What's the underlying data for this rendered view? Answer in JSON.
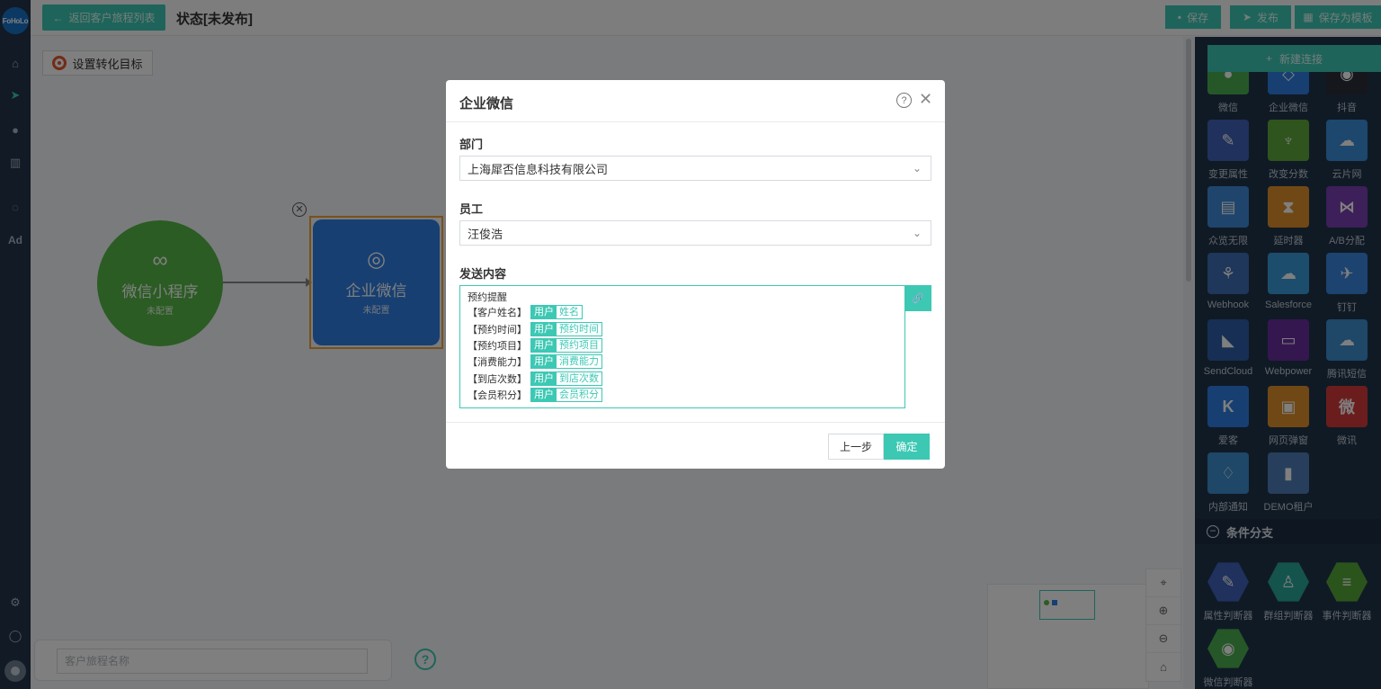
{
  "nav": {
    "logo": "FoHoLo",
    "ad_label": "Ad"
  },
  "topbar": {
    "back_label": "返回客户旅程列表",
    "status": "状态[未发布]",
    "save_label": "保存",
    "publish_label": "发布",
    "save_template_label": "保存为模板"
  },
  "canvas": {
    "goal_label": "设置转化目标",
    "node1": {
      "title": "微信小程序",
      "sub": "未配置"
    },
    "node2": {
      "title": "企业微信",
      "sub": "未配置"
    },
    "search_placeholder": "客户旅程名称",
    "help": "?"
  },
  "panel": {
    "new_connection": "新建连接",
    "tools": [
      {
        "label": "微信",
        "color": "#4caf50"
      },
      {
        "label": "企业微信",
        "color": "#2f7fe4"
      },
      {
        "label": "抖音",
        "color": "#2d2d3a"
      },
      {
        "label": "变更属性",
        "color": "#3f63b8"
      },
      {
        "label": "改变分数",
        "color": "#5ea83a"
      },
      {
        "label": "云片网",
        "color": "#3a8fd9"
      },
      {
        "label": "众览无限",
        "color": "#3e8bd8"
      },
      {
        "label": "延时器",
        "color": "#e0912a"
      },
      {
        "label": "A/B分配",
        "color": "#7b3fb3"
      },
      {
        "label": "Webhook",
        "color": "#3d6fb5"
      },
      {
        "label": "Salesforce",
        "color": "#3a9ad9"
      },
      {
        "label": "钉钉",
        "color": "#3a86e0"
      },
      {
        "label": "SendCloud",
        "color": "#2f5fa8"
      },
      {
        "label": "Webpower",
        "color": "#6a2fa0"
      },
      {
        "label": "腾讯短信",
        "color": "#3c8fd0"
      },
      {
        "label": "爱客",
        "color": "#2f7fe4"
      },
      {
        "label": "网页弹窗",
        "color": "#e0912a"
      },
      {
        "label": "微讯",
        "color": "#d63a3a"
      },
      {
        "label": "内部通知",
        "color": "#3c8fd0"
      },
      {
        "label": "DEMO租户",
        "color": "#4f7fb8"
      }
    ],
    "section": "条件分支",
    "judges": [
      {
        "label": "属性判断器",
        "color": "#3f63b8"
      },
      {
        "label": "群组判断器",
        "color": "#2aa69a"
      },
      {
        "label": "事件判断器",
        "color": "#56a83a"
      },
      {
        "label": "微信判断器",
        "color": "#4caf50"
      }
    ]
  },
  "modal": {
    "title": "企业微信",
    "dept_label": "部门",
    "dept_value": "上海犀否信息科技有限公司",
    "staff_label": "员工",
    "staff_value": "汪俊浩",
    "content_label": "发送内容",
    "content_heading": "预约提醒",
    "rows": [
      {
        "label": "【客户姓名】",
        "tag1": "用户",
        "tag2": "姓名"
      },
      {
        "label": "【预约时间】",
        "tag1": "用户",
        "tag2": "预约时间"
      },
      {
        "label": "【预约项目】",
        "tag1": "用户",
        "tag2": "预约项目"
      },
      {
        "label": "【消费能力】",
        "tag1": "用户",
        "tag2": "消费能力"
      },
      {
        "label": "【到店次数】",
        "tag1": "用户",
        "tag2": "到店次数"
      },
      {
        "label": "【会员积分】",
        "tag1": "用户",
        "tag2": "会员积分"
      }
    ],
    "prev_label": "上一步",
    "ok_label": "确定"
  }
}
